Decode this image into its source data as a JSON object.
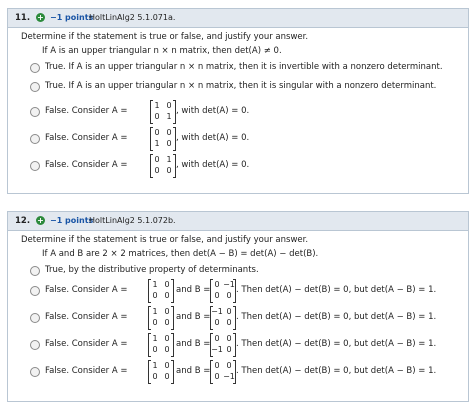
{
  "q1": {
    "number": "11.",
    "points": "−1 points",
    "source": "HoltLinAlg2 5.1.071a.",
    "instruction": "Determine if the statement is true or false, and justify your answer.",
    "statement": "If A is an upper triangular  n × n  matrix, then  det(A) ≠ 0.",
    "options": [
      {
        "text": "True. If A is an upper triangular n × n matrix, then it is invertible with a nonzero determinant."
      },
      {
        "text": "True. If A is an upper triangular n × n matrix, then it is singular with a nonzero determinant."
      },
      {
        "pre": "False. Consider  A =",
        "A": [
          "1",
          "0",
          "0",
          "1"
        ],
        "post": ", with det(A) = 0."
      },
      {
        "pre": "False. Consider  A =",
        "A": [
          "0",
          "0",
          "1",
          "0"
        ],
        "post": ", with det(A) = 0."
      },
      {
        "pre": "False. Consider  A =",
        "A": [
          "0",
          "1",
          "0",
          "0"
        ],
        "post": ", with det(A) = 0."
      }
    ]
  },
  "q2": {
    "number": "12.",
    "points": "−1 points",
    "source": "HoltLinAlg2 5.1.072b.",
    "instruction": "Determine if the statement is true or false, and justify your answer.",
    "statement": "If A and B are  2 × 2  matrices, then  det(A − B) = det(A) − det(B).",
    "options": [
      {
        "text": "True, by the distributive property of determinants."
      },
      {
        "pre": "False. Consider  A =",
        "A": [
          "1",
          "0",
          "0",
          "0"
        ],
        "mid": "and B =",
        "B": [
          "0",
          "−1",
          "0",
          "0"
        ],
        "post": ". Then det(A) − det(B) = 0, but det(A − B) = 1."
      },
      {
        "pre": "False. Consider  A =",
        "A": [
          "1",
          "0",
          "0",
          "0"
        ],
        "mid": "and B =",
        "B": [
          "−1",
          "0",
          "0",
          "0"
        ],
        "post": ". Then det(A) − det(B) = 0, but det(A − B) = 1."
      },
      {
        "pre": "False. Consider  A =",
        "A": [
          "1",
          "0",
          "0",
          "0"
        ],
        "mid": "and B =",
        "B": [
          "0",
          "0",
          "−1",
          "0"
        ],
        "post": ". Then det(A) − det(B) = 0, but det(A − B) = 1."
      },
      {
        "pre": "False. Consider  A =",
        "A": [
          "1",
          "0",
          "0",
          "0"
        ],
        "mid": "and B =",
        "B": [
          "0",
          "0",
          "0",
          "−1"
        ],
        "post": ". Then det(A) − det(B) = 0, but det(A − B) = 1."
      }
    ]
  }
}
